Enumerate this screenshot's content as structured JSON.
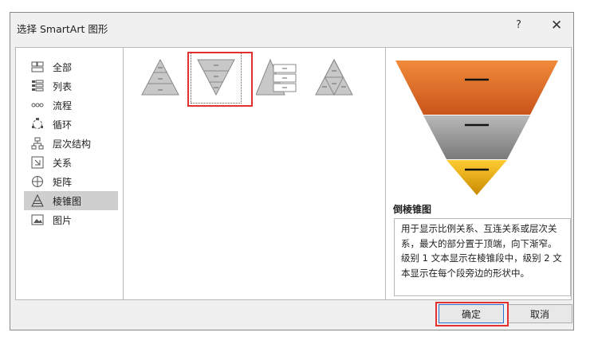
{
  "dialog": {
    "title": "选择 SmartArt 图形",
    "help_label": "?",
    "close_label": "✕"
  },
  "categories": [
    {
      "label": "全部",
      "icon": "all-icon"
    },
    {
      "label": "列表",
      "icon": "list-icon"
    },
    {
      "label": "流程",
      "icon": "process-icon"
    },
    {
      "label": "循环",
      "icon": "cycle-icon"
    },
    {
      "label": "层次结构",
      "icon": "hierarchy-icon"
    },
    {
      "label": "关系",
      "icon": "relationship-icon"
    },
    {
      "label": "矩阵",
      "icon": "matrix-icon"
    },
    {
      "label": "棱锥图",
      "icon": "pyramid-icon"
    },
    {
      "label": "图片",
      "icon": "picture-icon"
    }
  ],
  "selected_category": "棱锥图",
  "layouts": [
    {
      "icon": "basic-pyramid-icon"
    },
    {
      "icon": "inverted-pyramid-icon",
      "selected": true
    },
    {
      "icon": "pyramid-list-icon"
    },
    {
      "icon": "segmented-pyramid-icon"
    }
  ],
  "preview": {
    "name": "倒棱锥图",
    "description": "用于显示比例关系、互连关系或层次关系，最大的部分置于顶端，向下渐窄。级别 1 文本显示在棱锥段中，级别 2 文本显示在每个段旁边的形状中。",
    "colors": {
      "top": "#e8732a",
      "middle": "#9a9a9a",
      "bottom": "#f2b10a"
    }
  },
  "buttons": {
    "ok": "确定",
    "cancel": "取消"
  }
}
